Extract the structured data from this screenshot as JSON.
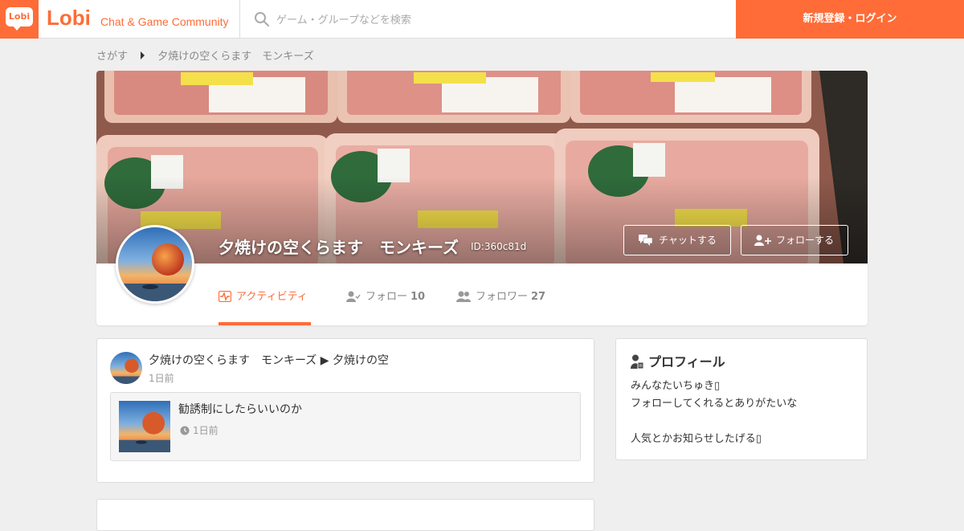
{
  "header": {
    "brand_logo": "Lobi",
    "brand_name": "Lobi",
    "brand_tagline": "Chat & Game Community",
    "search_placeholder": "ゲーム・グループなどを検索",
    "login_label": "新規登録・ログイン",
    "accent_color": "#ff6c37"
  },
  "breadcrumb": {
    "items": [
      "さがす",
      "夕焼けの空くらます　モンキーズ"
    ]
  },
  "profile": {
    "name": "夕焼けの空くらます　モンキーズ",
    "user_id": "ID:360c81d",
    "chat_button": "チャットする",
    "follow_button": "フォローする",
    "tabs": [
      {
        "label": "アクティビティ",
        "count": "",
        "icon": "activity-icon",
        "active": true
      },
      {
        "label": "フォロー",
        "count": "10",
        "icon": "user-check-icon",
        "active": false
      },
      {
        "label": "フォロワー",
        "count": "27",
        "icon": "users-icon",
        "active": false
      }
    ]
  },
  "activity": {
    "title": "夕焼けの空くらます　モンキーズ ▶ 夕焼けの空",
    "time": "1日前",
    "post": {
      "title": "勧誘制にしたらいいのか",
      "time": "1日前"
    }
  },
  "side_profile": {
    "title": "プロフィール",
    "bio_lines": [
      "みんなたいちゅき▯",
      "フォローしてくれるとありがたいな",
      "",
      "人気とかお知らせしたげる▯"
    ]
  }
}
